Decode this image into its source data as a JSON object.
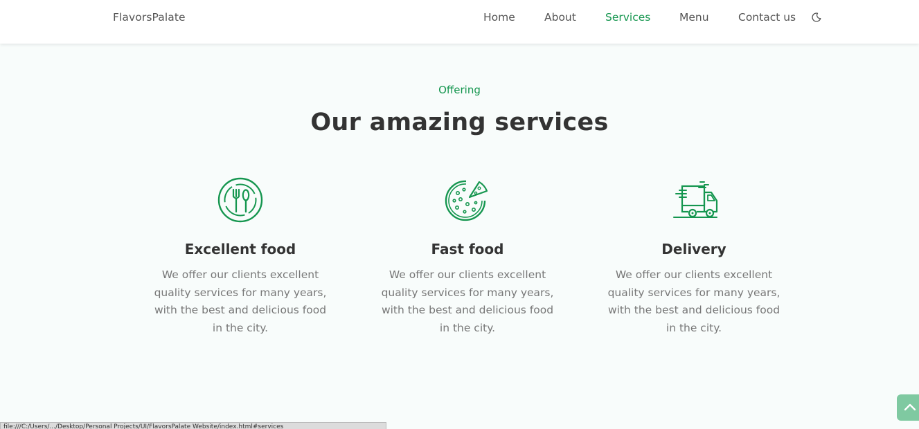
{
  "header": {
    "logo": "FlavorsPalate",
    "nav": [
      {
        "label": "Home",
        "active": false
      },
      {
        "label": "About",
        "active": false
      },
      {
        "label": "Services",
        "active": true
      },
      {
        "label": "Menu",
        "active": false
      },
      {
        "label": "Contact us",
        "active": false
      }
    ],
    "theme_icon": "moon-icon"
  },
  "section": {
    "subtitle": "Offering",
    "title": "Our amazing services"
  },
  "services": [
    {
      "icon": "cutlery-icon",
      "title": "Excellent food",
      "text": "We offer our clients excellent quality services for many years, with the best and delicious food in the city."
    },
    {
      "icon": "pizza-icon",
      "title": "Fast food",
      "text": "We offer our clients excellent quality services for many years, with the best and delicious food in the city."
    },
    {
      "icon": "delivery-truck-icon",
      "title": "Delivery",
      "text": "We offer our clients excellent quality services for many years, with the best and delicious food in the city."
    }
  ],
  "scroll_up_icon": "chevron-up-icon",
  "status_bar": {
    "text": "file:///C:/Users/.../Desktop/Personal Projects/UI/FlavorsPalate Website/index.html#services"
  },
  "colors": {
    "accent": "#15964f",
    "background": "#f8fcfb",
    "header_bg": "#ffffff",
    "text_dark": "#333333",
    "text_muted": "#777777",
    "scroll_button": "#7fc9a1"
  }
}
